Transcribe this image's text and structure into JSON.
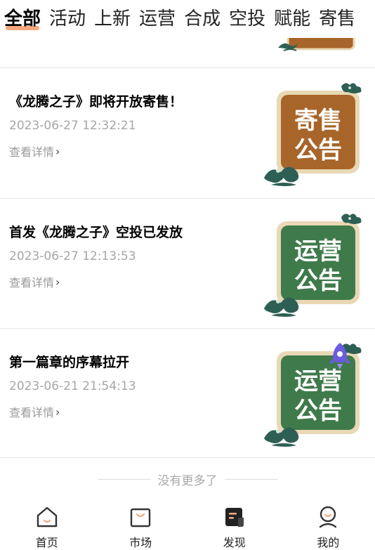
{
  "tabs": [
    {
      "label": "全部",
      "active": true
    },
    {
      "label": "活动"
    },
    {
      "label": "上新"
    },
    {
      "label": "运营"
    },
    {
      "label": "合成"
    },
    {
      "label": "空投"
    },
    {
      "label": "赋能"
    },
    {
      "label": "寄售"
    }
  ],
  "announcements": [
    {
      "title": "《龙腾之子》即将开放寄售！",
      "time": "2023-06-27 12:32:21",
      "detail": "查看详情",
      "badge": {
        "line1": "寄售",
        "line2": "公告",
        "color": "#a8652a",
        "icon": "consign-announcement-icon"
      }
    },
    {
      "title": "首发《龙腾之子》空投已发放",
      "time": "2023-06-27 12:13:53",
      "detail": "查看详情",
      "badge": {
        "line1": "运营",
        "line2": "公告",
        "color": "#3f7a4b",
        "icon": "operation-announcement-icon"
      }
    },
    {
      "title": "第一篇章的序幕拉开",
      "time": "2023-06-21 21:54:13",
      "detail": "查看详情",
      "badge": {
        "line1": "运营",
        "line2": "公告",
        "color": "#3f7a4b",
        "icon": "operation-announcement-icon"
      }
    }
  ],
  "no_more": "没有更多了",
  "bottom_nav": [
    {
      "label": "首页",
      "icon": "home-icon"
    },
    {
      "label": "市场",
      "icon": "market-bag-icon"
    },
    {
      "label": "发现",
      "icon": "discover-icon",
      "active": true
    },
    {
      "label": "我的",
      "icon": "profile-icon"
    }
  ],
  "colors": {
    "accent": "#f5a77d",
    "consign": "#a8652a",
    "operation": "#3f7a4b",
    "rocket": "#6a5be0"
  }
}
